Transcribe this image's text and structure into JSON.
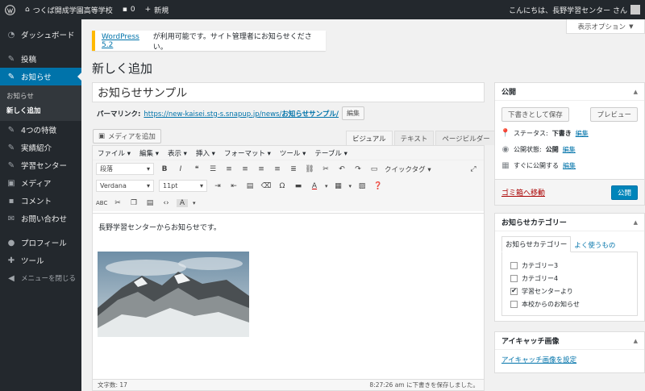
{
  "adminbar": {
    "site_name": "つくば開成学園高等学校",
    "comment_count": "0",
    "new_label": "新規",
    "greeting": "こんにちは、長野学習センター さん"
  },
  "sidebar": {
    "dashboard": "ダッシュボード",
    "posts": "投稿",
    "notices": "お知らせ",
    "sub_notices": "お知らせ",
    "sub_add_new": "新しく追加",
    "features": "4つの特徴",
    "results": "実績紹介",
    "learning_center": "学習センター",
    "media": "メディア",
    "comments": "コメント",
    "contact": "お問い合わせ",
    "profile": "プロフィール",
    "tools": "ツール",
    "collapse": "メニューを閉じる"
  },
  "screen_options": "表示オプション",
  "notice": {
    "link_text": "WordPress 5.2",
    "text": "が利用可能です。サイト管理者にお知らせください。"
  },
  "page_title": "新しく追加",
  "post": {
    "title": "お知らせサンプル",
    "permalink_label": "パーマリンク:",
    "permalink_base": "https://new-kaisei.stg-s.snapup.jp/news/",
    "permalink_slug": "お知らせサンプル/",
    "edit_button": "編集"
  },
  "editor": {
    "add_media": "メディアを追加",
    "tabs": [
      "ビジュアル",
      "テキスト",
      "ページビルダー"
    ],
    "menus": [
      "ファイル",
      "編集",
      "表示",
      "挿入",
      "フォーマット",
      "ツール",
      "テーブル"
    ],
    "format_select": "段落",
    "font_select": "Verdana",
    "size_select": "11pt",
    "quick_tags": "クイックタグ",
    "content_text": "長野学習センターからお知らせです。",
    "word_count": "文字数: 17",
    "draft_saved": "8:27:26 am に下書きを保存しました。"
  },
  "publish": {
    "heading": "公開",
    "save_draft": "下書きとして保存",
    "preview": "プレビュー",
    "status_label": "ステータス:",
    "status_value": "下書き",
    "visibility_label": "公開状態:",
    "visibility_value": "公開",
    "schedule_label": "すぐに公開する",
    "edit_link": "編集",
    "trash": "ゴミ箱へ移動",
    "publish_button": "公開"
  },
  "categories": {
    "heading": "お知らせカテゴリー",
    "tab_all": "お知らせカテゴリー",
    "tab_popular": "よく使うもの",
    "items": [
      {
        "label": "カテゴリー3",
        "checked": false
      },
      {
        "label": "カテゴリー4",
        "checked": false
      },
      {
        "label": "学習センターより",
        "checked": true
      },
      {
        "label": "本校からのお知らせ",
        "checked": false
      }
    ]
  },
  "featured_image": {
    "heading": "アイキャッチ画像",
    "set_link": "アイキャッチ画像を設定"
  },
  "colors": {
    "admin_dark": "#23282d",
    "accent": "#0073aa",
    "notice_border": "#ffb900",
    "trash": "#a00"
  }
}
